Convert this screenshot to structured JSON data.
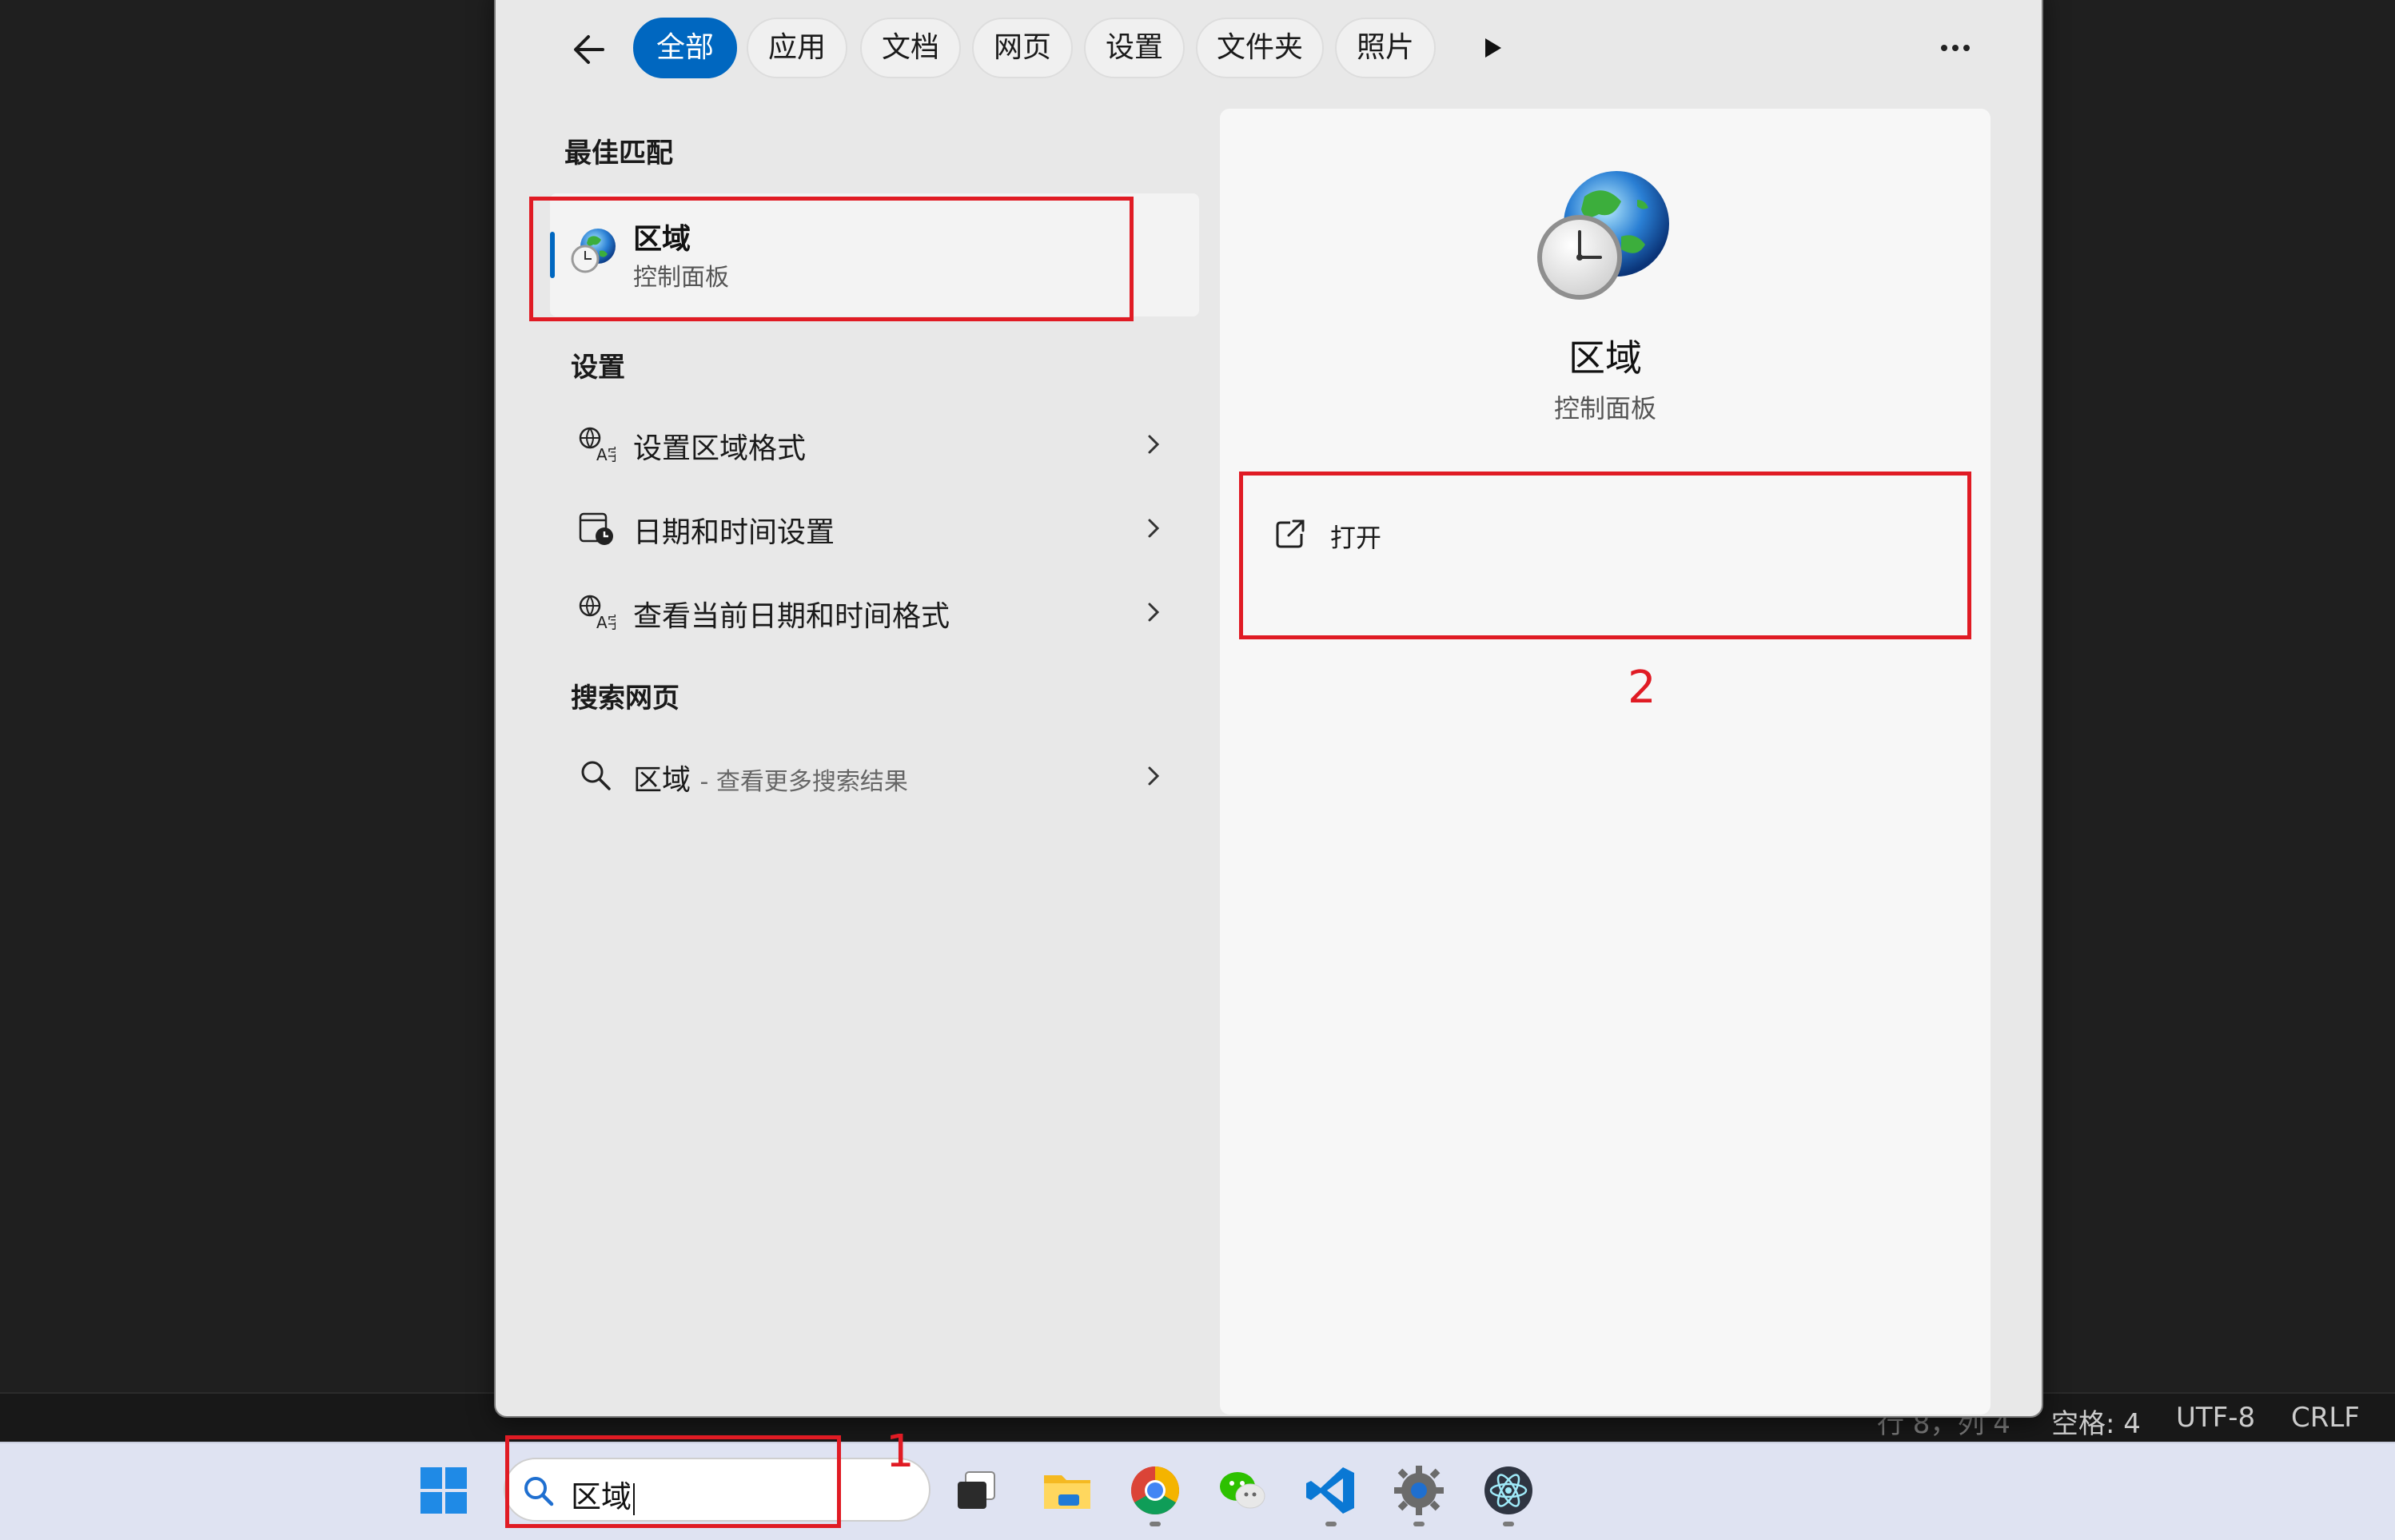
{
  "filters": {
    "tabs": [
      "全部",
      "应用",
      "文档",
      "网页",
      "设置",
      "文件夹",
      "照片"
    ],
    "active": "全部"
  },
  "best_match": {
    "heading": "最佳匹配",
    "title": "区域",
    "subtitle": "控制面板"
  },
  "settings_section": {
    "heading": "设置",
    "items": [
      {
        "label": "设置区域格式",
        "icon": "region-format-icon"
      },
      {
        "label": "日期和时间设置",
        "icon": "date-time-icon"
      },
      {
        "label": "查看当前日期和时间格式",
        "icon": "region-format-icon"
      }
    ]
  },
  "web_section": {
    "heading": "搜索网页",
    "query": "区域",
    "suffix": "- 查看更多搜索结果"
  },
  "detail": {
    "title": "区域",
    "subtitle": "控制面板",
    "action_open": "打开"
  },
  "annotations": {
    "marker_1": "1",
    "marker_2": "2",
    "color": "#e01b24"
  },
  "editor_status": {
    "position": "行 8，列 4",
    "spaces": "空格: 4",
    "encoding": "UTF-8",
    "eol": "CRLF"
  },
  "taskbar": {
    "search_text": "区域",
    "apps": [
      "start-icon",
      "task-view-icon",
      "file-explorer-icon",
      "chrome-icon",
      "wechat-icon",
      "vscode-icon",
      "settings-icon",
      "electron-app-icon"
    ]
  },
  "accent_color": "#0067c0"
}
